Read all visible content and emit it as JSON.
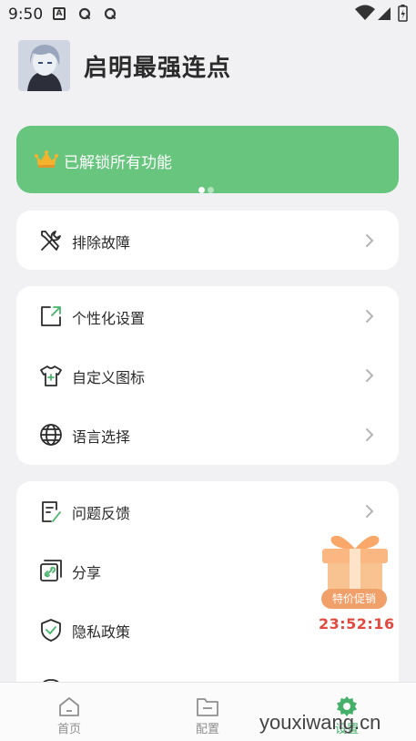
{
  "status_bar": {
    "time": "9:50",
    "notification_a": "A"
  },
  "header": {
    "app_title": "启明最强连点"
  },
  "banner": {
    "text": "已解锁所有功能",
    "page_count": 2,
    "active_page": 1
  },
  "cards": [
    {
      "items": [
        {
          "label": "排除故障",
          "icon": "wrench-screwdriver-icon"
        }
      ]
    },
    {
      "items": [
        {
          "label": "个性化设置",
          "icon": "external-link-icon"
        },
        {
          "label": "自定义图标",
          "icon": "tshirt-icon"
        },
        {
          "label": "语言选择",
          "icon": "globe-icon"
        }
      ]
    },
    {
      "items": [
        {
          "label": "问题反馈",
          "icon": "feedback-document-icon"
        },
        {
          "label": "分享",
          "icon": "share-link-icon"
        },
        {
          "label": "隐私政策",
          "icon": "shield-check-icon"
        }
      ]
    }
  ],
  "promo": {
    "badge": "特价促销",
    "timer": "23:52:16"
  },
  "bottom_nav": [
    {
      "label": "首页",
      "icon": "home-icon",
      "active": false
    },
    {
      "label": "配置",
      "icon": "folder-icon",
      "active": false
    },
    {
      "label": "设置",
      "icon": "gear-icon",
      "active": true
    }
  ],
  "watermark": "youxiwang.cn",
  "colors": {
    "accent": "#67c57d",
    "nav_active": "#44b06a",
    "timer": "#e14a3e",
    "promo_badge": "#f2a06a"
  }
}
